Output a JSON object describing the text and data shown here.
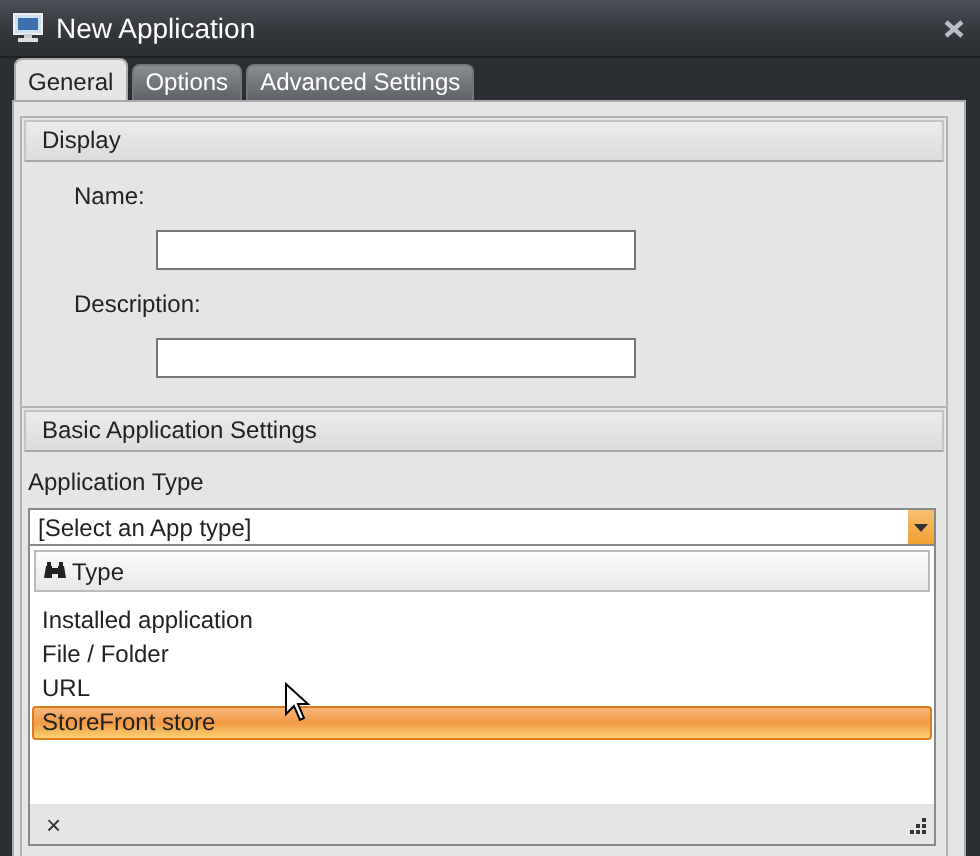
{
  "window": {
    "title": "New Application"
  },
  "tabs": [
    {
      "label": "General",
      "selected": true
    },
    {
      "label": "Options",
      "selected": false
    },
    {
      "label": "Advanced Settings",
      "selected": false
    }
  ],
  "display": {
    "title": "Display",
    "fields": [
      {
        "label": "Name:"
      },
      {
        "label": "Description:"
      }
    ]
  },
  "basic_settings": {
    "title": "Basic Application Settings",
    "app_type": {
      "label": "Application Type",
      "value": "[Select an App type]",
      "expanded": true,
      "list": {
        "column": "Type",
        "items": [
          {
            "label": "Installed application",
            "selected": false
          },
          {
            "label": "File / Folder",
            "selected": false
          },
          {
            "label": "URL",
            "selected": false
          },
          {
            "label": "StoreFront store",
            "selected": true
          }
        ],
        "clear": "×"
      }
    }
  }
}
